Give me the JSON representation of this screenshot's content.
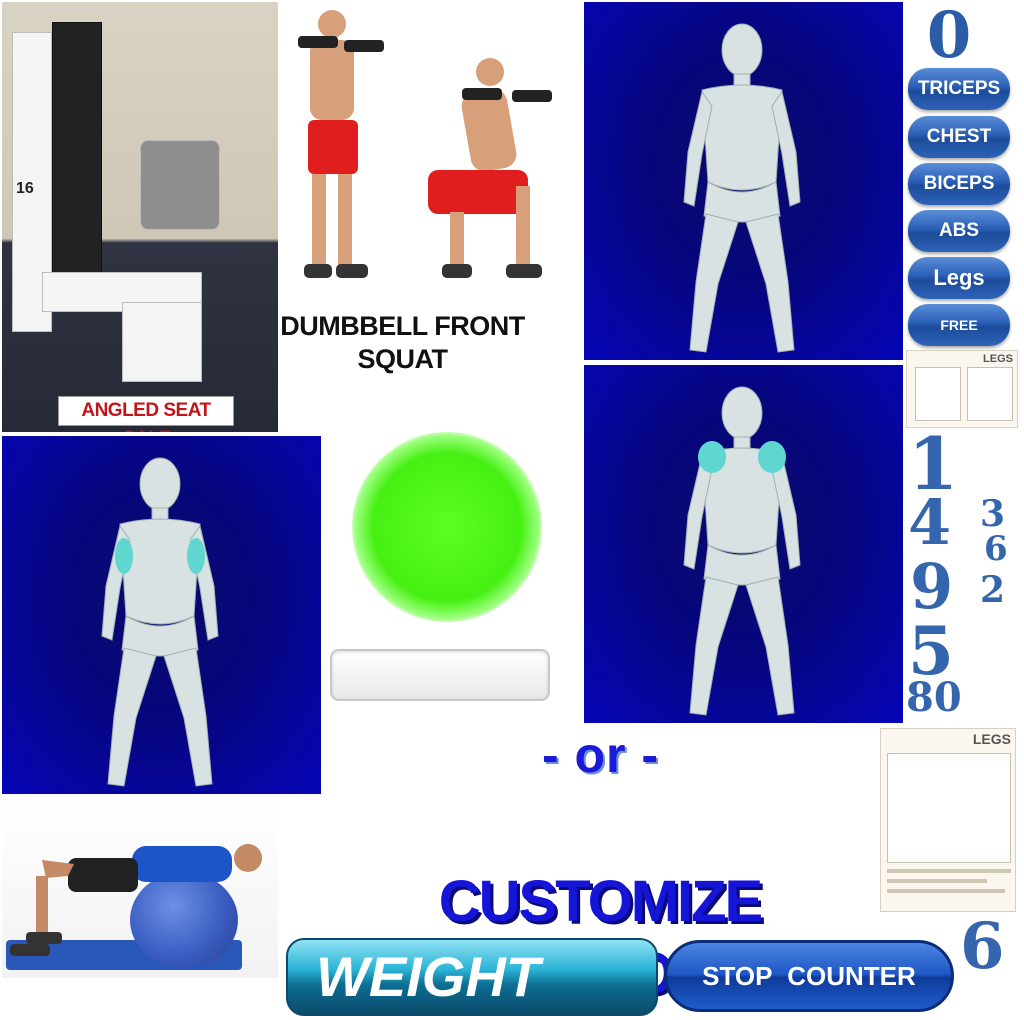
{
  "images": {
    "machine_label": "ANGLED SEAT CALF",
    "machine_number": "16",
    "squat_caption_line1": "DUMBBELL FRONT",
    "squat_caption_line2": "SQUAT",
    "chart_title_small": "LEGS",
    "chart_title_big": "LEGS"
  },
  "muscle_buttons": [
    {
      "label": "TRICEPS"
    },
    {
      "label": "CHEST"
    },
    {
      "label": "BICEPS"
    },
    {
      "label": "ABS"
    },
    {
      "label": "Legs"
    },
    {
      "label": "FREE WEIGHTS"
    }
  ],
  "counter_digits": {
    "zero": "0",
    "d1": "1",
    "d4": "4",
    "d3": "3",
    "d6": "6",
    "d9": "9",
    "d2": "2",
    "d5": "5",
    "d80": "80",
    "d6_bottom": "6"
  },
  "separator_text": "- or -",
  "title": "CUSTOMIZE WORKOUT",
  "actions": {
    "weight_label": "WEIGHT",
    "stop_counter_label": "STOP COUNTER"
  },
  "input": {
    "value": ""
  },
  "colors": {
    "indicator_green": "#46f012",
    "button_blue": "#2a5fb6",
    "title_blue": "#1515d8",
    "highlight_cyan": "#5fd6d0"
  }
}
